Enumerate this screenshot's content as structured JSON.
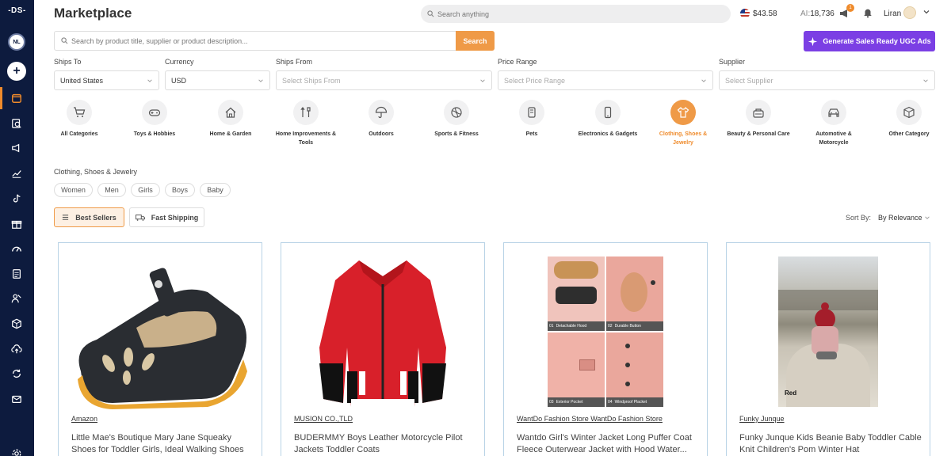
{
  "sidebar": {
    "logo": "-DS-",
    "avatar": "NL",
    "items": [
      "store-icon",
      "search-doc-icon",
      "megaphone-icon",
      "analytics-icon",
      "tiktok-icon",
      "gift-icon",
      "gauge-icon",
      "document-icon",
      "users-icon",
      "box-icon",
      "cloud-upload-icon",
      "sync-icon",
      "mail-icon",
      "settings-icon"
    ]
  },
  "header": {
    "title": "Marketplace",
    "search_placeholder": "Search anything",
    "balance": "$43.58",
    "ai_label": "AI:",
    "ai_credits": "18,736",
    "notif_count": "1",
    "user_name": "Liran"
  },
  "product_search": {
    "placeholder": "Search by product title, supplier or product description...",
    "button": "Search"
  },
  "ugc_button": "Generate Sales Ready UGC Ads",
  "filters": {
    "ships_to": {
      "label": "Ships To",
      "value": "United States"
    },
    "currency": {
      "label": "Currency",
      "value": "USD"
    },
    "ships_from": {
      "label": "Ships From",
      "placeholder": "Select Ships From"
    },
    "price_range": {
      "label": "Price Range",
      "placeholder": "Select Price Range"
    },
    "supplier": {
      "label": "Supplier",
      "placeholder": "Select Supplier"
    }
  },
  "categories": [
    {
      "label": "All Categories",
      "icon": "cart-icon"
    },
    {
      "label": "Toys & Hobbies",
      "icon": "gamepad-icon"
    },
    {
      "label": "Home & Garden",
      "icon": "home-icon"
    },
    {
      "label": "Home Improvements & Tools",
      "icon": "tools-icon"
    },
    {
      "label": "Outdoors",
      "icon": "umbrella-icon"
    },
    {
      "label": "Sports & Fitness",
      "icon": "ball-icon"
    },
    {
      "label": "Pets",
      "icon": "pet-icon"
    },
    {
      "label": "Electronics & Gadgets",
      "icon": "phone-icon"
    },
    {
      "label": "Clothing, Shoes & Jewelry",
      "icon": "shirt-icon",
      "active": true
    },
    {
      "label": "Beauty & Personal Care",
      "icon": "beauty-icon"
    },
    {
      "label": "Automotive & Motorcycle",
      "icon": "car-icon"
    },
    {
      "label": "Other Category",
      "icon": "package-icon"
    }
  ],
  "subcategory": {
    "title": "Clothing, Shoes & Jewelry",
    "chips": [
      "Women",
      "Men",
      "Girls",
      "Boys",
      "Baby"
    ]
  },
  "toolbar": {
    "best_sellers": "Best Sellers",
    "fast_shipping": "Fast Shipping",
    "sort_label": "Sort By:",
    "sort_value": "By Relevance"
  },
  "products": [
    {
      "supplier": "Amazon",
      "title": "Little Mae's Boutique Mary Jane Squeaky Shoes for Toddler Girls, Ideal Walking Shoes with..."
    },
    {
      "supplier": "MUSION CO.,TLD",
      "title": "BUDERMMY Boys Leather Motorcycle Pilot Jackets Toddler Coats"
    },
    {
      "supplier": "WantDo Fashion Store WantDo Fashion Store",
      "title": "Wantdo Girl's Winter Jacket Long Puffer Coat Fleece Outerwear Jacket with Hood Water...",
      "image_labels": [
        "Detachable Hood",
        "Durable Button",
        "Exterior Pocket",
        "Windproof Placket"
      ],
      "image_numbers": [
        "01",
        "02",
        "03",
        "04"
      ]
    },
    {
      "supplier": "Funky Junque",
      "title": "Funky Junque Kids Beanie Baby Toddler Cable Knit Children's Pom Winter Hat",
      "image_badge": "Red"
    }
  ],
  "colors": {
    "accent": "#ef9a47",
    "sidebar": "#0d1b3e",
    "ugc": "#7b3fe4"
  }
}
